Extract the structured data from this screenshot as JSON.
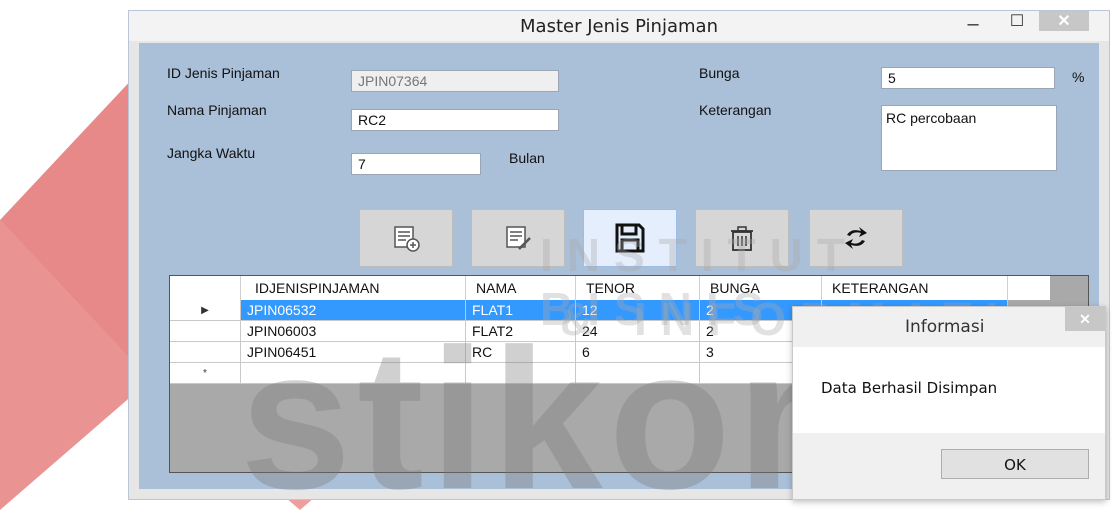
{
  "window": {
    "title": "Master Jenis Pinjaman",
    "minimize": "–",
    "maximize": "☐",
    "close": "✕"
  },
  "form": {
    "id_label": "ID Jenis Pinjaman",
    "id_value": "JPIN07364",
    "nama_label": "Nama Pinjaman",
    "nama_value": "RC2",
    "jangka_label": "Jangka Waktu",
    "jangka_value": "7",
    "jangka_unit": "Bulan",
    "bunga_label": "Bunga",
    "bunga_value": "5",
    "bunga_unit": "%",
    "ket_label": "Keterangan",
    "ket_value": "RC percobaan"
  },
  "toolbar": [
    {
      "name": "add-record-icon"
    },
    {
      "name": "edit-record-icon"
    },
    {
      "name": "save-icon"
    },
    {
      "name": "delete-icon"
    },
    {
      "name": "refresh-icon"
    }
  ],
  "grid": {
    "headers": [
      "IDJENISPINJAMAN",
      "NAMA",
      "TENOR",
      "BUNGA",
      "KETERANGAN"
    ],
    "rows": [
      [
        "JPIN06532",
        "FLAT1",
        "12",
        "2",
        ""
      ],
      [
        "JPIN06003",
        "FLAT2",
        "24",
        "2",
        ""
      ],
      [
        "JPIN06451",
        "RC",
        "6",
        "3",
        ""
      ]
    ],
    "current_marker": "▶",
    "new_marker": "*"
  },
  "dialog": {
    "title": "Informasi",
    "close": "✕",
    "message": "Data Berhasil Disimpan",
    "ok_label": "OK"
  },
  "watermark": {
    "line1": "INSTITUT BISNIS",
    "line2": "& INFORMATIKA",
    "brand": "stikom"
  }
}
